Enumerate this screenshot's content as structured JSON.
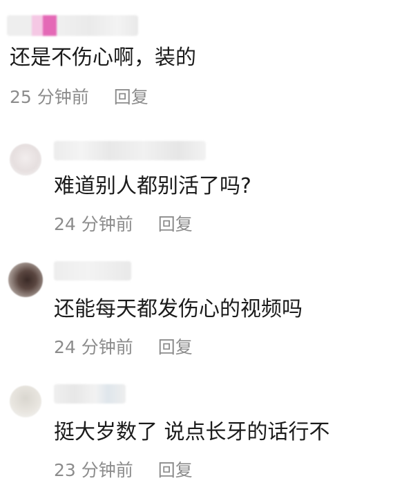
{
  "comments": {
    "top": {
      "text": "还是不伤心啊，装的",
      "time": "25 分钟前",
      "reply_label": "回复"
    },
    "replies": [
      {
        "text": "难道别人都别活了吗?",
        "time": "24 分钟前",
        "reply_label": "回复"
      },
      {
        "text": "还能每天都发伤心的视频吗",
        "time": "24 分钟前",
        "reply_label": "回复"
      },
      {
        "text": "挺大岁数了 说点长牙的话行不",
        "time": "23 分钟前",
        "reply_label": "回复"
      }
    ]
  }
}
